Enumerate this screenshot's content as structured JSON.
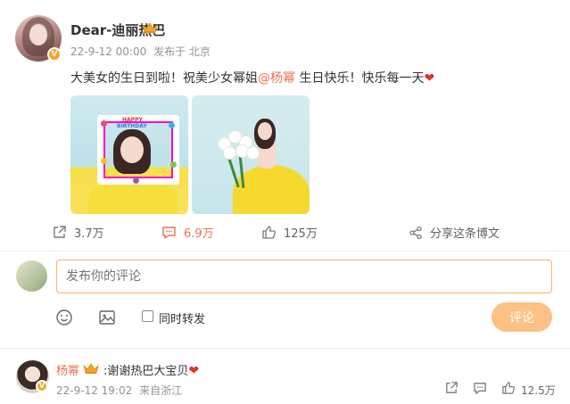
{
  "post": {
    "author": "Dear-迪丽热巴",
    "date": "22-9-12 00:00",
    "source": "发布于 北京",
    "text_before": "大美女的生日到啦！祝美少女幂姐",
    "mention": "@杨幂",
    "text_after": " 生日快乐！快乐每一天",
    "heart": "❤",
    "images": [
      "birthday-frame-photo",
      "flower-bouquet-photo"
    ],
    "image_text": [
      "HAPPY",
      "BIRTHDAY"
    ]
  },
  "actions": {
    "share_count": "3.7万",
    "comment_count": "6.9万",
    "like_count": "125万",
    "forward_label": "分享这条博文"
  },
  "composer": {
    "placeholder": "发布你的评论",
    "repost_label": "同时转发",
    "submit_label": "评论"
  },
  "reply": {
    "author": "杨幂",
    "text": ":谢谢热巴大宝贝",
    "heart": "❤",
    "date": "22-9-12 19:02",
    "location": "来自浙江",
    "like_count": "12.5万"
  },
  "colors": {
    "accent": "#eb7350",
    "submit_bg": "#fcc184",
    "input_border": "#f2b46f",
    "badge": "#f5a623"
  },
  "icons": [
    "share-icon",
    "comment-icon",
    "like-icon",
    "forward-icon",
    "emoji-icon",
    "image-icon",
    "crown-icon",
    "verified-icon"
  ]
}
